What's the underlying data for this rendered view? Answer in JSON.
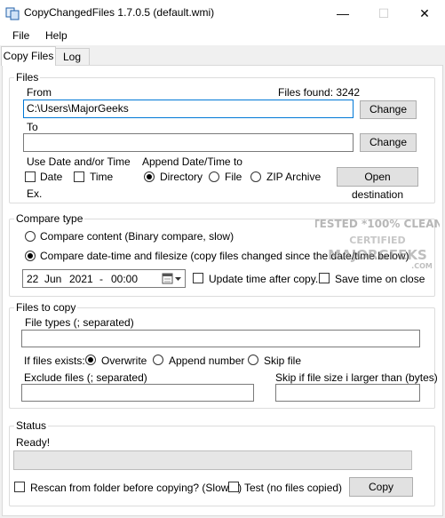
{
  "window": {
    "title": "CopyChangedFiles 1.7.0.5 (default.wmi)",
    "controls": {
      "minimize": "—",
      "maximize": "☐",
      "close": "✕"
    }
  },
  "menu": [
    "File",
    "Help"
  ],
  "tabs": [
    "Copy Files",
    "Log"
  ],
  "files": {
    "group_label": "Files",
    "from_label": "From",
    "files_found": "Files found: 3242",
    "from_value": "C:\\Users\\MajorGeeks",
    "change_label": "Change",
    "to_label": "To",
    "to_value": "",
    "use_date_label": "Use Date and/or Time",
    "date_label": "Date",
    "time_label": "Time",
    "append_label": "Append Date/Time to",
    "append_options": [
      "Directory",
      "File",
      "ZIP Archive"
    ],
    "open_destination": "Open destination",
    "ex_label": "Ex."
  },
  "compare": {
    "group_label": "Compare type",
    "option_content": "Compare content (Binary compare, slow)",
    "option_datetime": "Compare date-time and filesize (copy files changed since the date/time below)",
    "date": {
      "day": "22",
      "month": "Jun",
      "year": "2021",
      "sep": "-",
      "time": "00:00"
    },
    "update_time": "Update time after copy.",
    "save_time": "Save time on close"
  },
  "copy": {
    "group_label": "Files to copy",
    "types_label": "File types (; separated)",
    "types_value": "",
    "exists_label": "If files exists:",
    "exists_options": [
      "Overwrite",
      "Append number",
      "Skip file"
    ],
    "exclude_label": "Exclude files (; separated)",
    "exclude_value": "",
    "skip_size_label": "Skip if file size i larger than (bytes)",
    "skip_size_value": ""
  },
  "status": {
    "group_label": "Status",
    "text": "Ready!",
    "progress": 0,
    "rescan_label": "Rescan from folder before copying? (Slower)",
    "test_label": "Test (no files copied)",
    "copy_button": "Copy"
  }
}
